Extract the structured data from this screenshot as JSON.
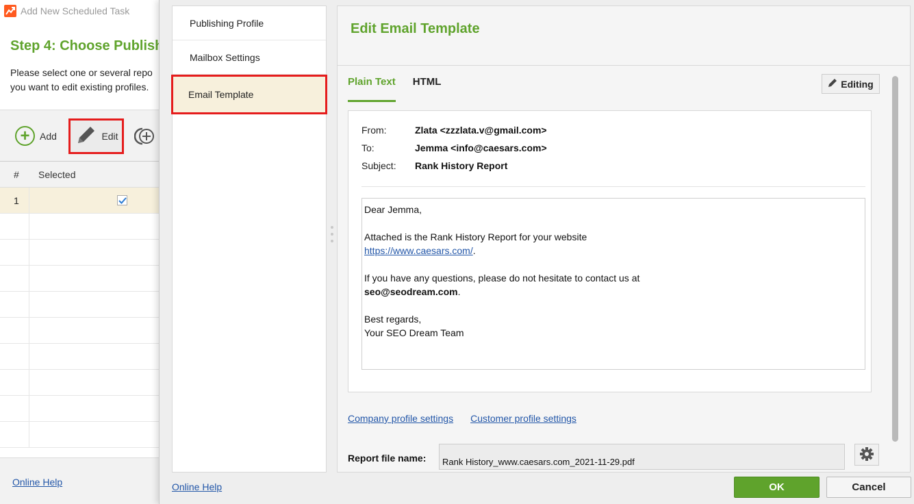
{
  "background_window": {
    "title": "Add New Scheduled Task",
    "step_title": "Step 4: Choose Publish",
    "description_line1": "Please select one or several repo",
    "description_line2": "you want to edit existing profiles.",
    "toolbar": {
      "add_label": "Add",
      "edit_label": "Edit"
    },
    "table": {
      "col_num": "#",
      "col_selected": "Selected",
      "rows": [
        {
          "num": "1",
          "selected": true
        }
      ]
    },
    "online_help": "Online Help"
  },
  "dialog": {
    "nav": {
      "items": [
        {
          "label": "Publishing Profile"
        },
        {
          "label": "Mailbox Settings"
        },
        {
          "label": "Email Template"
        }
      ],
      "active_index": 2
    },
    "main": {
      "title": "Edit Email Template",
      "tabs": [
        {
          "label": "Plain Text"
        },
        {
          "label": "HTML"
        }
      ],
      "active_tab": 0,
      "editing_label": "Editing",
      "email": {
        "from_label": "From:",
        "from_value": "Zlata <zzzlata.v@gmail.com>",
        "to_label": "To:",
        "to_value": "Jemma <info@caesars.com>",
        "subject_label": "Subject:",
        "subject_value": "Rank History Report",
        "body": {
          "greeting": "Dear Jemma,",
          "line1": "Attached is the Rank History Report for your website",
          "link": "https://www.caesars.com/",
          "link_suffix": ".",
          "line2": "If you have any questions, please do not hesitate to contact us at",
          "contact_email": "seo@seodream.com",
          "contact_suffix": ".",
          "regards": "Best regards,",
          "signature": "Your SEO Dream Team"
        }
      },
      "company_profile_link": "Company profile settings",
      "customer_profile_link": "Customer profile settings",
      "report_file_label": "Report file name:",
      "report_file_value": "Rank History_www.caesars.com_2021-11-29.pdf"
    },
    "online_help": "Online Help",
    "ok_label": "OK",
    "cancel_label": "Cancel"
  },
  "colors": {
    "accent_green": "#5fa32c",
    "highlight_red": "#e51c1c",
    "link_blue": "#2256a8",
    "selected_row": "#f7f0dc"
  }
}
